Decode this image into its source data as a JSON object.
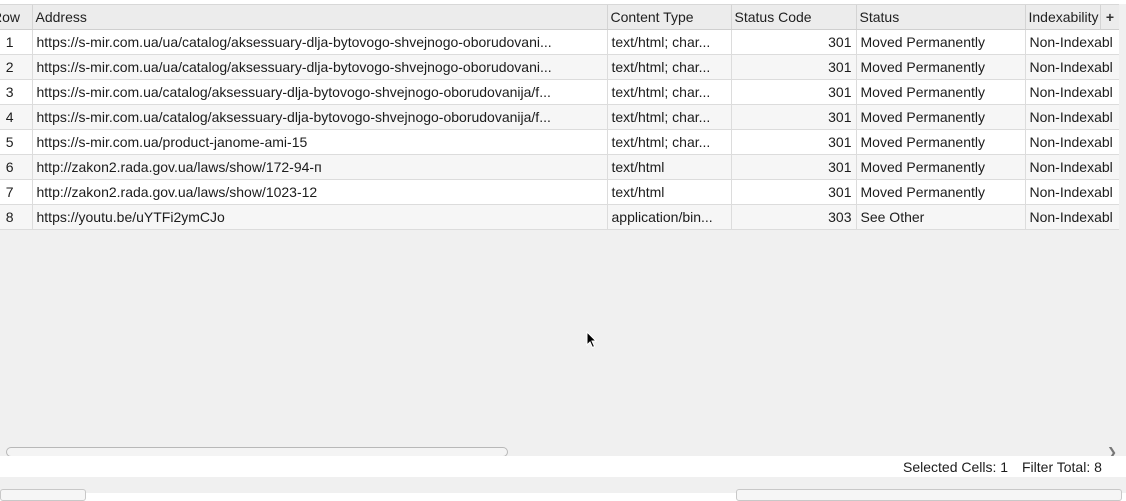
{
  "columns": {
    "row": "Row",
    "address": "Address",
    "content_type": "Content Type",
    "status_code": "Status Code",
    "status": "Status",
    "indexability": "Indexability",
    "add_column": "+"
  },
  "rows": [
    {
      "row": "1",
      "address": "https://s-mir.com.ua/ua/catalog/aksessuary-dlja-bytovogo-shvejnogo-oborudovani...",
      "content_type": "text/html; char...",
      "status_code": "301",
      "status": "Moved Permanently",
      "indexability": "Non-Indexabl"
    },
    {
      "row": "2",
      "address": "https://s-mir.com.ua/ua/catalog/aksessuary-dlja-bytovogo-shvejnogo-oborudovani...",
      "content_type": "text/html; char...",
      "status_code": "301",
      "status": "Moved Permanently",
      "indexability": "Non-Indexabl"
    },
    {
      "row": "3",
      "address": "https://s-mir.com.ua/catalog/aksessuary-dlja-bytovogo-shvejnogo-oborudovanija/f...",
      "content_type": "text/html; char...",
      "status_code": "301",
      "status": "Moved Permanently",
      "indexability": "Non-Indexabl"
    },
    {
      "row": "4",
      "address": "https://s-mir.com.ua/catalog/aksessuary-dlja-bytovogo-shvejnogo-oborudovanija/f...",
      "content_type": "text/html; char...",
      "status_code": "301",
      "status": "Moved Permanently",
      "indexability": "Non-Indexabl"
    },
    {
      "row": "5",
      "address": "https://s-mir.com.ua/product-janome-ami-15",
      "content_type": "text/html; char...",
      "status_code": "301",
      "status": "Moved Permanently",
      "indexability": "Non-Indexabl"
    },
    {
      "row": "6",
      "address": "http://zakon2.rada.gov.ua/laws/show/172-94-п",
      "content_type": "text/html",
      "status_code": "301",
      "status": "Moved Permanently",
      "indexability": "Non-Indexabl"
    },
    {
      "row": "7",
      "address": "http://zakon2.rada.gov.ua/laws/show/1023-12",
      "content_type": "text/html",
      "status_code": "301",
      "status": "Moved Permanently",
      "indexability": "Non-Indexabl"
    },
    {
      "row": "8",
      "address": "https://youtu.be/uYTFi2ymCJo",
      "content_type": "application/bin...",
      "status_code": "303",
      "status": "See Other",
      "indexability": "Non-Indexabl"
    }
  ],
  "statusbar": {
    "selected_cells": "Selected Cells:  1",
    "filter_total": "Filter Total:  8"
  },
  "colors": {
    "header_bg": "#ececec",
    "row_alt_bg": "#f6f6f6",
    "empty_bg": "#f0f0f0"
  }
}
